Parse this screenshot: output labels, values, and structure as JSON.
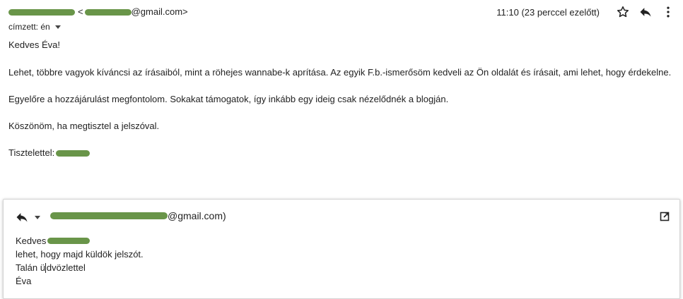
{
  "header": {
    "sender_email_prefix": "<",
    "sender_email_domain": "@gmail.com>",
    "time": "11:10 (23 perccel ezelőtt)",
    "recipient_label": "címzett: én"
  },
  "message": {
    "greeting": "Kedves Éva!",
    "paragraph1": "Lehet, többre vagyok kíváncsi az írásaiból, mint a röhejes wannabe-k aprítása. Az egyik F.b.-ismerősöm kedveli az Ön oldalát és írásait, ami lehet, hogy érdekelne.",
    "paragraph2": "Egyelőre a hozzájárulást megfontolom. Sokakat támogatok, így inkább egy ideig csak nézelődnék a blogján.",
    "paragraph3": "Köszönöm, ha megtisztel a jelszóval.",
    "signoff": "Tisztelettel:"
  },
  "reply": {
    "recipient_email_domain": "@gmail.com)",
    "line1_prefix": "Kedves",
    "line2": "lehet, hogy majd küldök jelszót.",
    "line3_before_cursor": "Talán ü",
    "line3_after_cursor": "dvözlettel",
    "line4": "Éva"
  },
  "icons": {
    "star": "star-icon",
    "reply": "reply-icon",
    "more": "more-vertical-icon",
    "dropdown": "chevron-down-icon",
    "popout": "popout-icon"
  },
  "colors": {
    "text": "#222222",
    "redaction": "#5c8c3a",
    "border": "#d4d4d4"
  }
}
